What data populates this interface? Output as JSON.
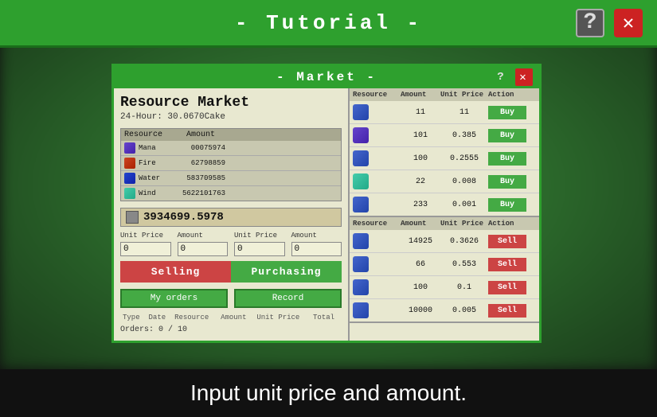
{
  "tutorial": {
    "title": "- Tutorial -",
    "hint_icon": "?",
    "close_icon": "✕"
  },
  "market": {
    "title": "- Market -",
    "resource_market_title": "Resource Market",
    "hour_display": "24-Hour: 30.0670Cake",
    "balance": "3934699.5978",
    "unit_price_label": "Unit Price",
    "amount_label": "Amount",
    "unit_price_value": "0",
    "amount_value": "0",
    "unit_price_value2": "0",
    "amount_value2": "0",
    "btn_selling": "Selling",
    "btn_purchasing": "Purchasing",
    "btn_my_orders": "My orders",
    "btn_record": "Record",
    "orders_count": "Orders: 0 / 10",
    "table_headers": [
      "Type",
      "Date",
      "Resource",
      "Amount",
      "Unit Price",
      "Total"
    ],
    "resource_list": {
      "headers": [
        "Resource",
        "Amount"
      ],
      "items": [
        {
          "name": "Mana",
          "amount": "00075974",
          "color": "res-mana"
        },
        {
          "name": "Fire",
          "amount": "62798859",
          "color": "res-fire"
        },
        {
          "name": "Water",
          "amount": "583709585",
          "color": "res-water"
        },
        {
          "name": "Wind",
          "amount": "5622101763",
          "color": "res-wind"
        }
      ]
    },
    "buy_orders": {
      "header": [
        "Resource",
        "Amount",
        "Unit Price",
        "Action"
      ],
      "rows": [
        {
          "amount": "11",
          "unit_price": "11",
          "btn": "Buy"
        },
        {
          "amount": "101",
          "unit_price": "0.385",
          "btn": "Buy"
        },
        {
          "amount": "100",
          "unit_price": "0.2555",
          "btn": "Buy"
        },
        {
          "amount": "22",
          "unit_price": "0.008",
          "btn": "Buy"
        },
        {
          "amount": "233",
          "unit_price": "0.001",
          "btn": "Buy"
        }
      ]
    },
    "sell_orders": {
      "header": [
        "Resource",
        "Amount",
        "Unit Price",
        "Action"
      ],
      "rows": [
        {
          "amount": "14925",
          "unit_price": "0.3626",
          "btn": "Sell"
        },
        {
          "amount": "66",
          "unit_price": "0.553",
          "btn": "Sell"
        },
        {
          "amount": "100",
          "unit_price": "0.1",
          "btn": "Sell"
        },
        {
          "amount": "10000",
          "unit_price": "0.005",
          "btn": "Sell"
        }
      ]
    }
  },
  "instruction": {
    "text": "Input unit price and amount."
  }
}
